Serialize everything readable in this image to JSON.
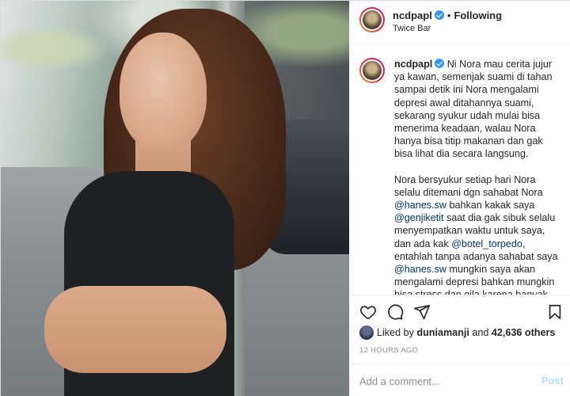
{
  "post": {
    "username": "ncdpapl",
    "follow_separator": "•",
    "follow_status": "Following",
    "location": "Twice Bar"
  },
  "caption": {
    "username": "ncdpapl",
    "p1": "Ni Nora mau cerita jujur ya kawan, semenjak suami di tahan sampai detik ini Nora mengalami depresi awal ditahannya suami, sekarang syukur udah mulai bisa menerima keadaan, walau Nora hanya bisa titip makanan dan gak bisa lihat dia secara langsung.",
    "p2_a": "Nora bersyukur setiap hari Nora selalu ditemani dgn sahabat Nora ",
    "mention1": "@hanes.sw",
    "p2_b": " bahkan kakak saya ",
    "mention2": "@genjiketit",
    "p2_c": " saat dia gak sibuk selalu menyempatkan waktu untuk saya, dan ada kak ",
    "mention3": "@botel_torpedo",
    "p2_d": ", entahlah tanpa adanya sahabat saya ",
    "mention4": "@hanes.sw",
    "p2_e": " mungkin saya akan mengalami depresi bahkan mungkin bisa stress dan gila karena banyak pikiran"
  },
  "likes": {
    "prefix": "Liked by ",
    "user": "duniamanji",
    "middle": " and ",
    "others": "42,636 others"
  },
  "timestamp": "12 HOURS AGO",
  "comment_box": {
    "placeholder": "Add a comment...",
    "post_label": "Post"
  },
  "icons": [
    "heart-icon",
    "comment-icon",
    "share-icon",
    "bookmark-icon",
    "verified-badge-icon"
  ],
  "colors": {
    "verified": "#3897f0",
    "mention": "#00376b",
    "post_disabled": "#b2dffc",
    "muted": "#8e8e8e"
  }
}
